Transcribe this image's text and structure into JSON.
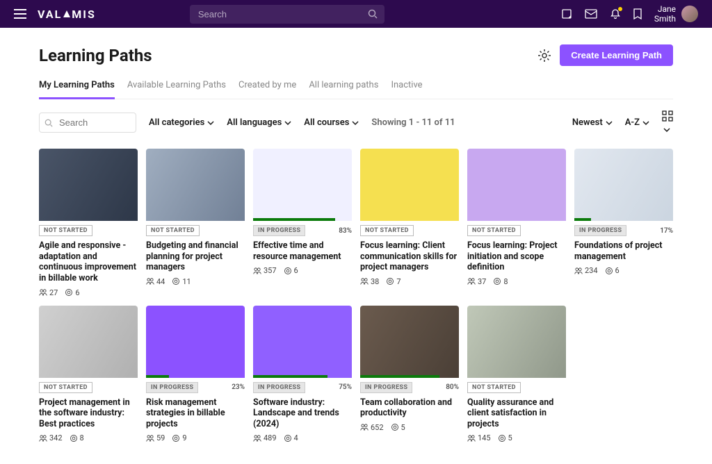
{
  "header": {
    "search_placeholder": "Search",
    "user_first": "Jane",
    "user_last": "Smith"
  },
  "page": {
    "title": "Learning Paths",
    "create_btn": "Create Learning Path"
  },
  "tabs": [
    "My Learning Paths",
    "Available Learning Paths",
    "Created by me",
    "All learning paths",
    "Inactive"
  ],
  "filters": {
    "search_placeholder": "Search",
    "categories": "All categories",
    "languages": "All languages",
    "courses": "All courses",
    "results": "Showing 1 - 11 of 11",
    "sort_newest": "Newest",
    "sort_az": "A-Z"
  },
  "status": {
    "not_started": "NOT STARTED",
    "in_progress": "IN PROGRESS"
  },
  "cards": [
    {
      "title": "Agile and responsive - adaptation and continuous improvement in billable work",
      "status": "not_started",
      "pct": null,
      "learners": 27,
      "courses": 6,
      "img": "img-a"
    },
    {
      "title": "Budgeting and financial planning for project managers",
      "status": "not_started",
      "pct": null,
      "learners": 44,
      "courses": 11,
      "img": "img-b"
    },
    {
      "title": "Effective time and resource management",
      "status": "in_progress",
      "pct": "83%",
      "learners": 357,
      "courses": 6,
      "img": "img-c"
    },
    {
      "title": "Focus learning: Client communication skills for project managers",
      "status": "not_started",
      "pct": null,
      "learners": 38,
      "courses": 7,
      "img": "img-d"
    },
    {
      "title": "Focus learning: Project initiation and scope definition",
      "status": "not_started",
      "pct": null,
      "learners": 37,
      "courses": 8,
      "img": "img-e"
    },
    {
      "title": "Foundations of project management",
      "status": "in_progress",
      "pct": "17%",
      "learners": 234,
      "courses": 6,
      "img": "img-f"
    },
    {
      "title": "Project management in the software industry: Best practices",
      "status": "not_started",
      "pct": null,
      "learners": 342,
      "courses": 8,
      "img": "img-g"
    },
    {
      "title": "Risk management strategies in billable projects",
      "status": "in_progress",
      "pct": "23%",
      "learners": 59,
      "courses": 9,
      "img": "img-h"
    },
    {
      "title": "Software industry: Landscape and trends (2024)",
      "status": "in_progress",
      "pct": "75%",
      "learners": 489,
      "courses": 4,
      "img": "img-i"
    },
    {
      "title": "Team collaboration and productivity",
      "status": "in_progress",
      "pct": "80%",
      "learners": 652,
      "courses": 5,
      "img": "img-j"
    },
    {
      "title": "Quality assurance and client satisfaction in projects",
      "status": "not_started",
      "pct": null,
      "learners": 145,
      "courses": 5,
      "img": "img-k"
    }
  ]
}
